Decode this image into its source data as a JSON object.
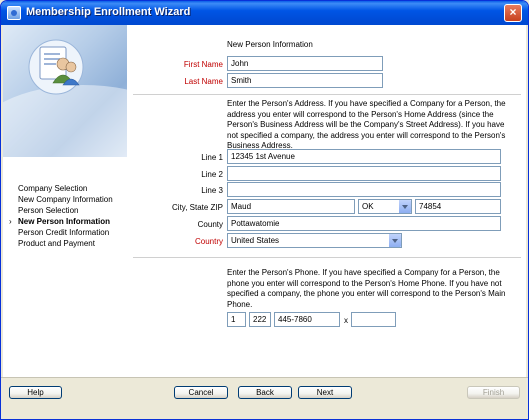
{
  "window": {
    "title": "Membership Enrollment Wizard"
  },
  "sidebar": {
    "items": [
      {
        "label": "Company Selection",
        "active": false
      },
      {
        "label": "New Company Information",
        "active": false
      },
      {
        "label": "Person Selection",
        "active": false
      },
      {
        "label": "New Person Information",
        "active": true
      },
      {
        "label": "Person Credit Information",
        "active": false
      },
      {
        "label": "Product and Payment",
        "active": false
      }
    ]
  },
  "main": {
    "section_title": "New Person Information",
    "first_name": {
      "label": "First Name",
      "value": "John"
    },
    "last_name": {
      "label": "Last Name",
      "value": "Smith"
    },
    "address_help": "Enter the Person's Address. If you have specified a Company for a Person, the address you enter will correspond to the Person's Home Address (since the Person's Business Address will be the Company's Street Address). If you have not specified a company, the address you enter will correspond to the Person's Business Address.",
    "line1": {
      "label": "Line 1",
      "value": "12345 1st Avenue"
    },
    "line2": {
      "label": "Line 2",
      "value": ""
    },
    "line3": {
      "label": "Line 3",
      "value": ""
    },
    "city_state_zip": {
      "label": "City, State ZIP",
      "city": "Maud",
      "state": "OK",
      "zip": "74854"
    },
    "county": {
      "label": "County",
      "value": "Pottawatomie"
    },
    "country": {
      "label": "Country",
      "value": "United States"
    },
    "phone_help": "Enter the Person's Phone. If you have specified a Company for a Person, the phone you enter will correspond to the Person's Home Phone. If you have not specified a company, the phone you enter will correspond to the Person's Main Phone.",
    "phone": {
      "country_code": "1",
      "area_code": "222",
      "number": "445-7860",
      "ext_label": "x",
      "extension": ""
    }
  },
  "footer": {
    "help": "Help",
    "cancel": "Cancel",
    "back": "Back",
    "next": "Next",
    "finish": "Finish"
  }
}
